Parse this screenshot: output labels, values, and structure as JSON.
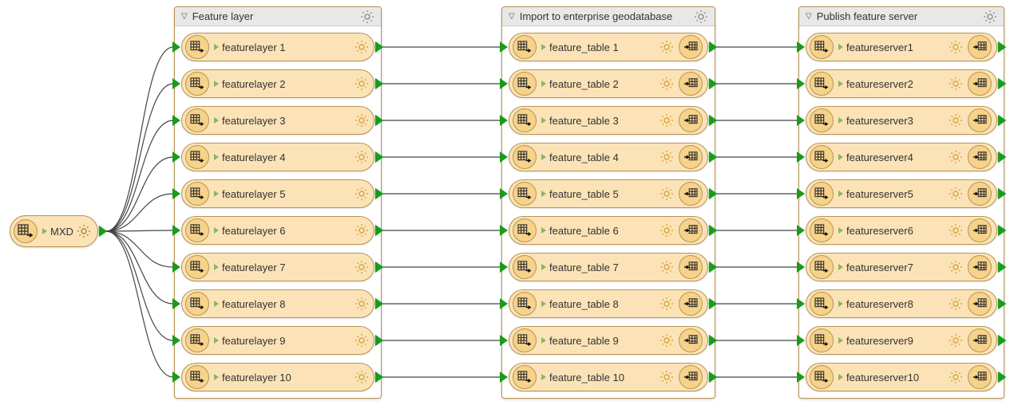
{
  "source": {
    "label": "MXD"
  },
  "groups": [
    {
      "title": "Feature layer",
      "items": [
        "featurelayer 1",
        "featurelayer 2",
        "featurelayer 3",
        "featurelayer 4",
        "featurelayer 5",
        "featurelayer 6",
        "featurelayer 7",
        "featurelayer 8",
        "featurelayer 9",
        "featurelayer 10"
      ],
      "has_trailing_icon": false
    },
    {
      "title": "Import to enterprise geodatabase",
      "items": [
        "feature_table 1",
        "feature_table 2",
        "feature_table 3",
        "feature_table 4",
        "feature_table 5",
        "feature_table 6",
        "feature_table 7",
        "feature_table 8",
        "feature_table 9",
        "feature_table 10"
      ],
      "has_trailing_icon": true
    },
    {
      "title": "Publish feature server",
      "items": [
        "featureserver1",
        "featureserver2",
        "featureserver3",
        "featureserver4",
        "featureserver5",
        "featureserver6",
        "featureserver7",
        "featureserver8",
        "featureserver9",
        "featureserver10"
      ],
      "has_trailing_icon": true
    }
  ],
  "diagram": {
    "row_count": 10,
    "connections": [
      {
        "from": "source",
        "to": "group1_all"
      },
      {
        "from": "group1",
        "to": "group2"
      },
      {
        "from": "group2",
        "to": "group3"
      }
    ]
  }
}
